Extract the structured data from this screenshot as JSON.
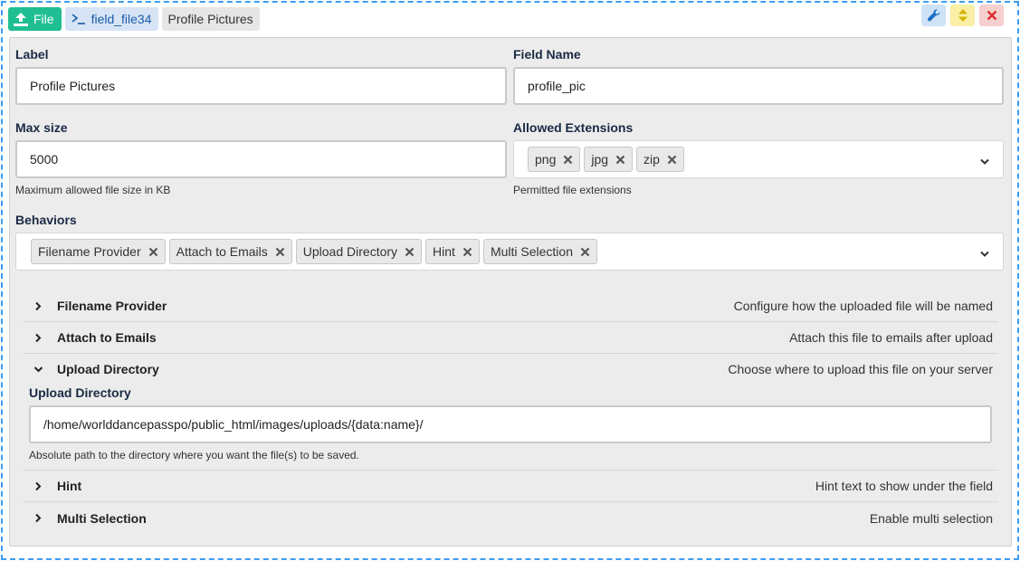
{
  "header": {
    "type_badge": "File",
    "key_badge": "field_file34",
    "label_badge": "Profile Pictures"
  },
  "tools": {
    "settings_icon": "wrench-icon",
    "move_icon": "up-down-icon",
    "remove_icon": "close-icon"
  },
  "colors": {
    "frame_border": "#3b9cf0",
    "file_badge": "#1fbf93",
    "key_badge": "#d6e4f5",
    "wrench": "#1b6fc4",
    "move": "#d4b300",
    "close": "#d9302f"
  },
  "fields": {
    "label": {
      "title": "Label",
      "value": "Profile Pictures"
    },
    "field_name": {
      "title": "Field Name",
      "value": "profile_pic"
    },
    "max_size": {
      "title": "Max size",
      "value": "5000",
      "help": "Maximum allowed file size in KB"
    },
    "allowed_extensions": {
      "title": "Allowed Extensions",
      "values": [
        "png",
        "jpg",
        "zip"
      ],
      "help": "Permitted file extensions"
    },
    "behaviors": {
      "title": "Behaviors",
      "values": [
        "Filename Provider",
        "Attach to Emails",
        "Upload Directory",
        "Hint",
        "Multi Selection"
      ]
    }
  },
  "sections": [
    {
      "title": "Filename Provider",
      "desc": "Configure how the uploaded file will be named",
      "expanded": false
    },
    {
      "title": "Attach to Emails",
      "desc": "Attach this file to emails after upload",
      "expanded": false
    },
    {
      "title": "Upload Directory",
      "desc": "Choose where to upload this file on your server",
      "expanded": true
    },
    {
      "title": "Hint",
      "desc": "Hint text to show under the field",
      "expanded": false
    },
    {
      "title": "Multi Selection",
      "desc": "Enable multi selection",
      "expanded": false
    }
  ],
  "upload_directory": {
    "title": "Upload Directory",
    "value": "/home/worlddancepasspo/public_html/images/uploads/{data:name}/",
    "help": "Absolute path to the directory where you want the file(s) to be saved."
  }
}
